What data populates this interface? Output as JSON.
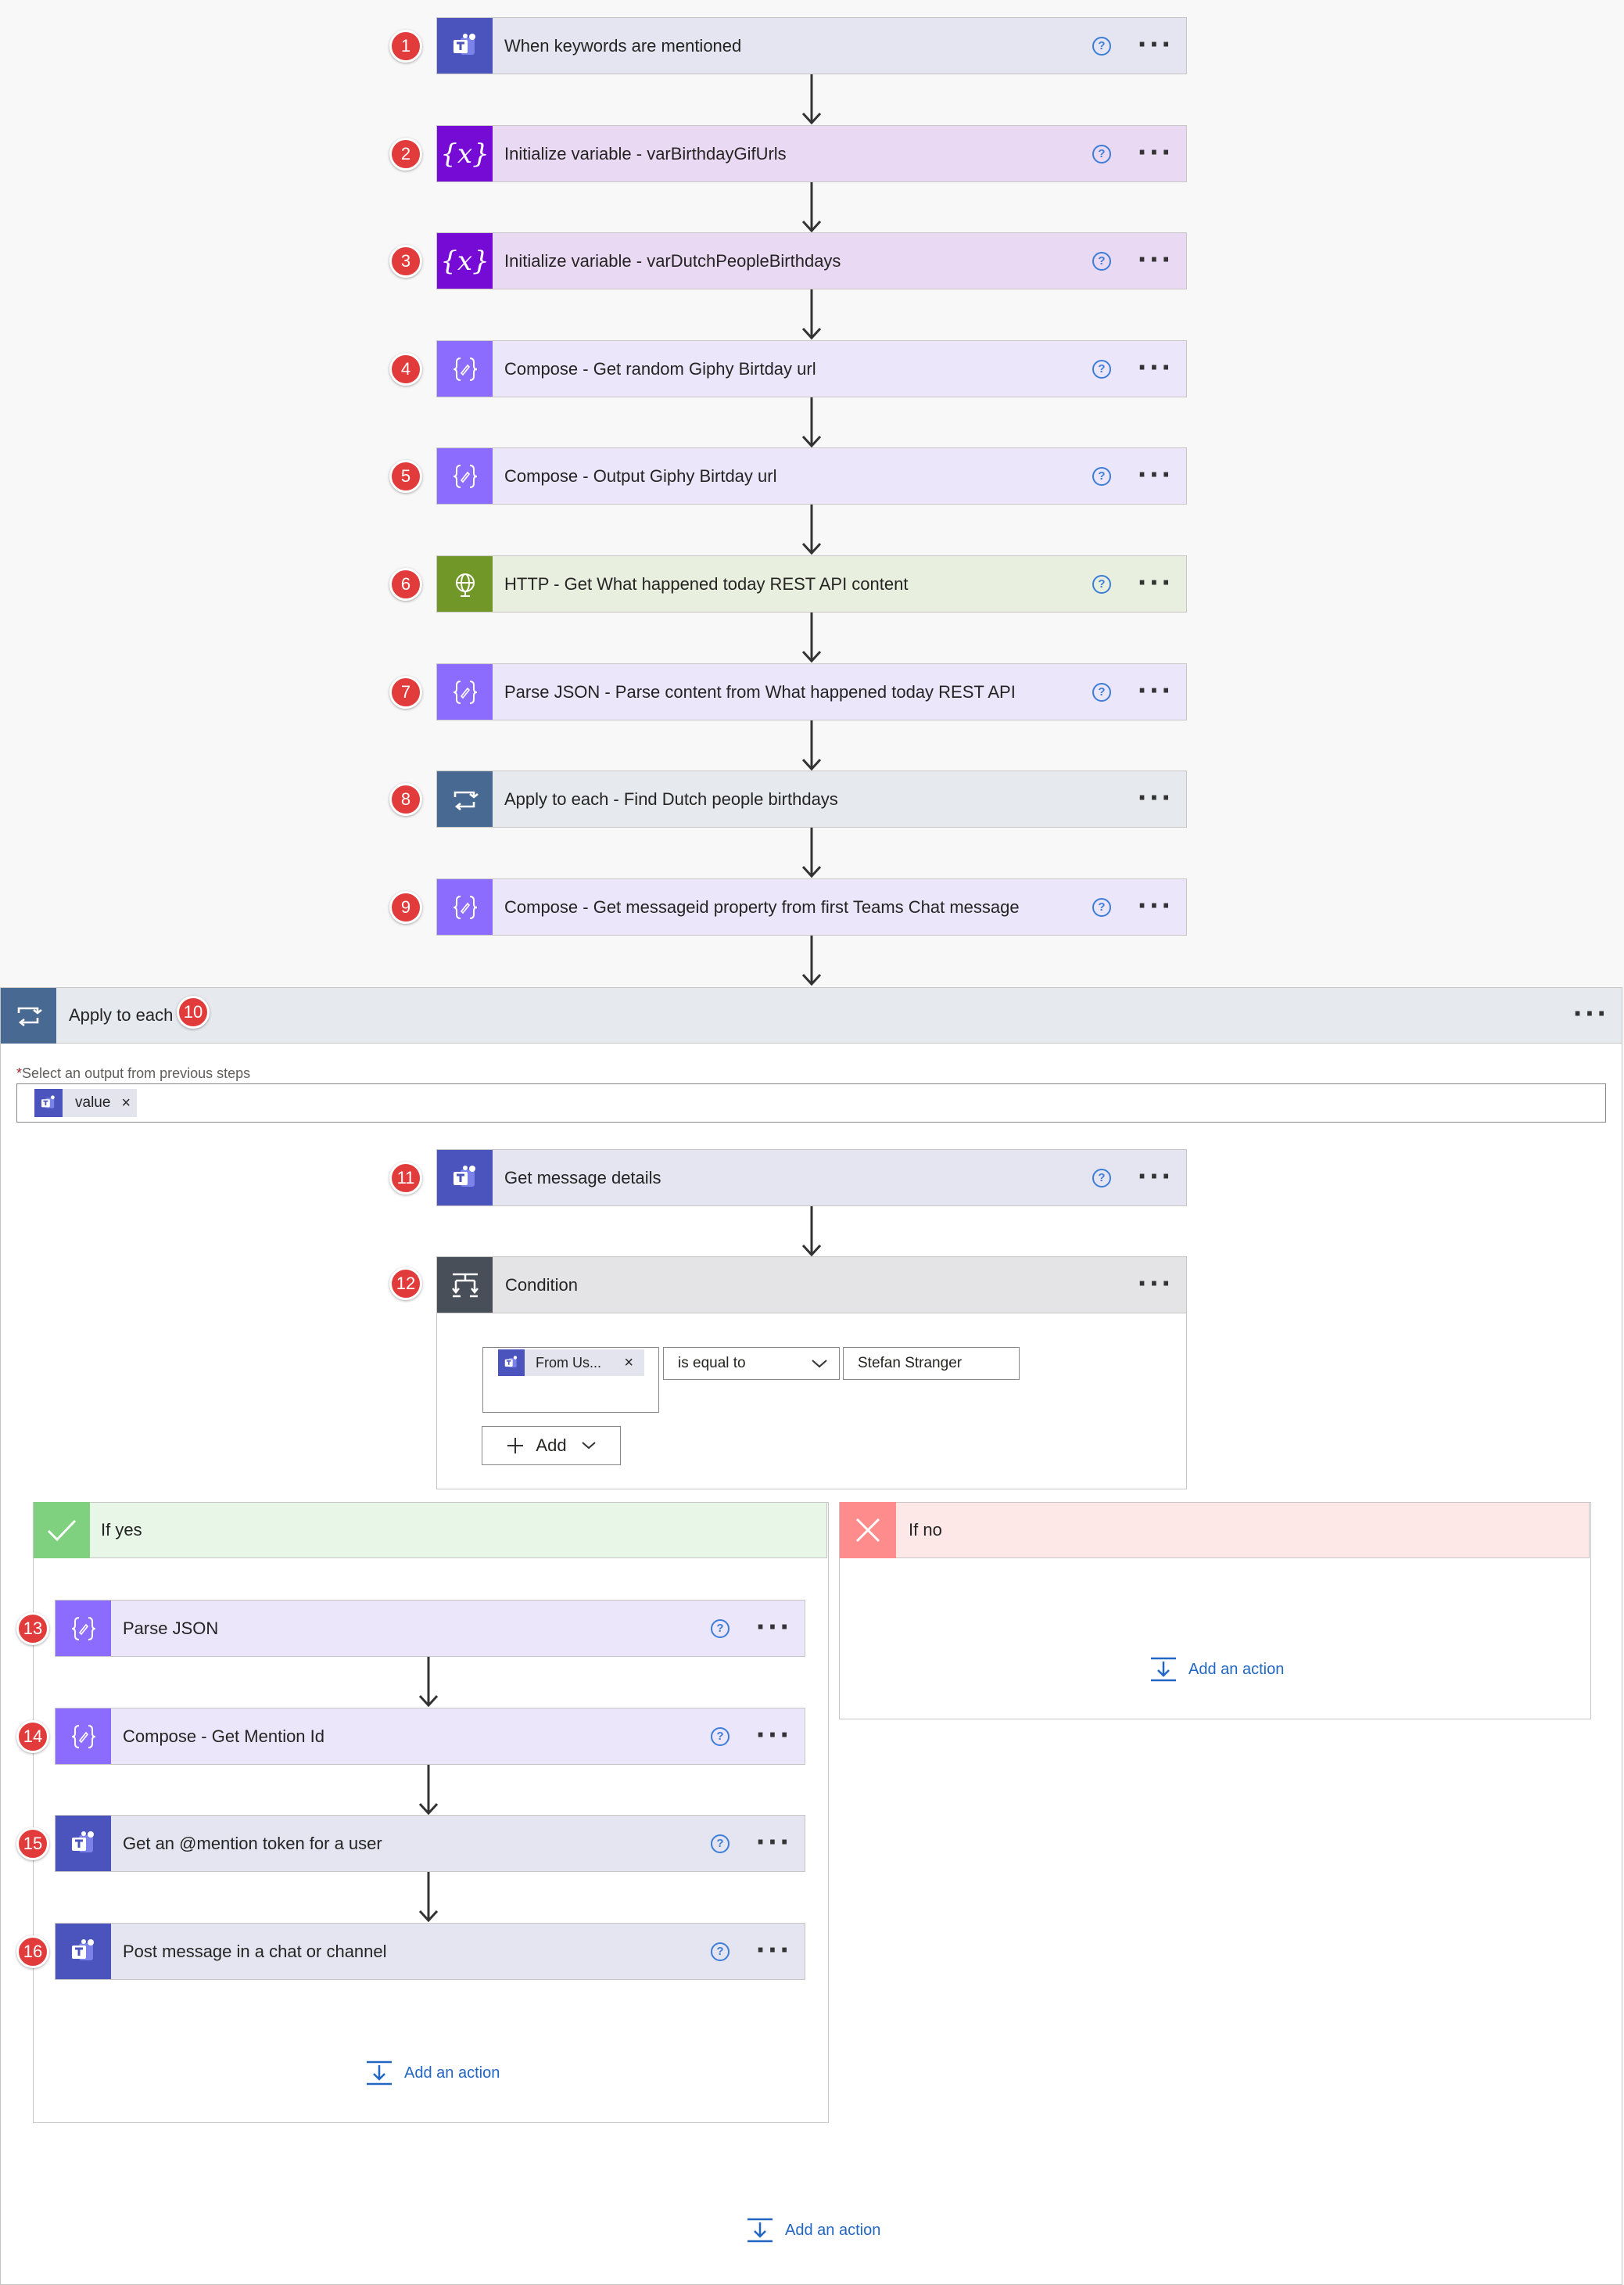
{
  "actions": [
    {
      "title": "When keywords are mentioned",
      "badge": "1",
      "icon": "teams-icon"
    },
    {
      "title": "Initialize variable - varBirthdayGifUrls",
      "badge": "2",
      "icon": "variable-icon"
    },
    {
      "title": "Initialize variable - varDutchPeopleBirthdays",
      "badge": "3",
      "icon": "variable-icon"
    },
    {
      "title": "Compose - Get random Giphy Birtday url",
      "badge": "4",
      "icon": "compose-icon"
    },
    {
      "title": "Compose - Output Giphy Birtday url",
      "badge": "5",
      "icon": "compose-icon"
    },
    {
      "title": "HTTP - Get What happened today REST API content",
      "badge": "6",
      "icon": "globe-icon"
    },
    {
      "title": "Parse JSON - Parse content from What happened today REST API",
      "badge": "7",
      "icon": "compose-icon"
    },
    {
      "title": "Apply to each - Find Dutch people birthdays",
      "badge": "8",
      "icon": "loop-icon"
    },
    {
      "title": "Compose - Get messageid property from first Teams Chat message",
      "badge": "9",
      "icon": "compose-icon"
    }
  ],
  "loop": {
    "title": "Apply to each",
    "badge": "10",
    "select_label": "Select an output from previous steps",
    "required_mark": "*",
    "token_label": "value",
    "token_remove": "×"
  },
  "inner": {
    "get_message": {
      "title": "Get message details",
      "badge": "11"
    },
    "condition": {
      "title": "Condition",
      "badge": "12",
      "left_token": "From Us...",
      "left_token_remove": "×",
      "operator": "is equal to",
      "right_value": "Stefan Stranger",
      "add_label": "Add"
    }
  },
  "if_yes": {
    "label": "If yes",
    "actions": [
      {
        "title": "Parse JSON",
        "badge": "13"
      },
      {
        "title": "Compose - Get Mention Id",
        "badge": "14"
      },
      {
        "title": "Get an @mention token for a user",
        "badge": "15"
      },
      {
        "title": "Post message in a chat or channel",
        "badge": "16"
      }
    ],
    "add_action": "Add an action"
  },
  "if_no": {
    "label": "If no",
    "add_action": "Add an action"
  },
  "bottom_add_action": "Add an action",
  "help_glyph": "?",
  "colors": {
    "teams": "#4b53bc",
    "variable": "#770bd6",
    "compose": "#8c6cff",
    "http": "#709727",
    "loop": "#486991",
    "condition": "#484f58",
    "yes": "#7fd07f",
    "no": "#ff8c8c",
    "badge": "#e23b3b",
    "link": "#2266c3"
  }
}
